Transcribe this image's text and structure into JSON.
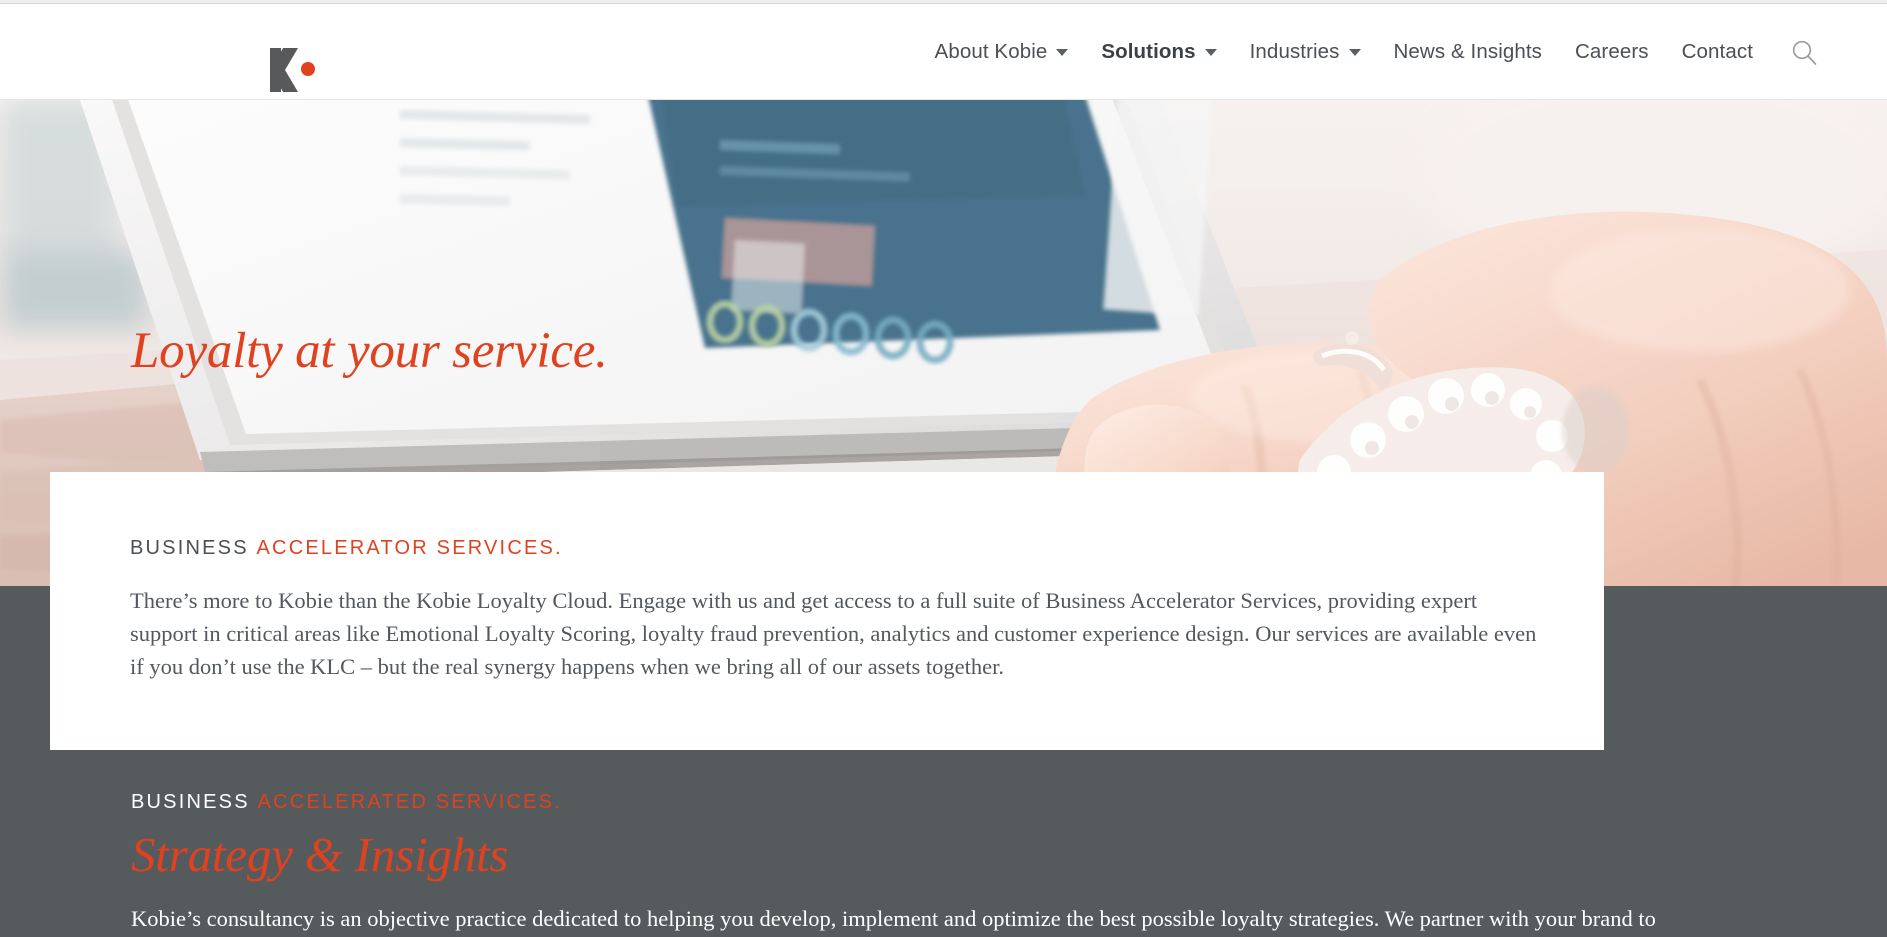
{
  "header": {
    "logo_name": "kobie-logo",
    "nav": [
      {
        "label": "About Kobie",
        "has_caret": true,
        "active": false
      },
      {
        "label": "Solutions",
        "has_caret": true,
        "active": true
      },
      {
        "label": "Industries",
        "has_caret": true,
        "active": false
      },
      {
        "label": "News & Insights",
        "has_caret": false,
        "active": false
      },
      {
        "label": "Careers",
        "has_caret": false,
        "active": false
      },
      {
        "label": "Contact",
        "has_caret": false,
        "active": false
      }
    ],
    "search_icon": "search-icon"
  },
  "hero": {
    "title": "Loyalty at your service.",
    "image_alt": "hands typing on a laptop at a wooden desk"
  },
  "card": {
    "eyebrow_primary": "BUSINESS",
    "eyebrow_accent": "ACCELERATOR SERVICES.",
    "paragraph": "There’s more to Kobie than the Kobie Loyalty Cloud. Engage with us and get access to a full suite of Business Accelerator Services, providing expert support in critical areas like Emotional Loyalty Scoring, loyalty fraud prevention, analytics and customer experience design. Our services are available even if you don’t use the KLC – but the real synergy happens when we bring all of our assets together."
  },
  "dark_section": {
    "eyebrow_primary": "BUSINESS",
    "eyebrow_accent": "ACCELERATED SERVICES.",
    "heading": "Strategy & Insights",
    "paragraph": "Kobie’s consultancy is an objective practice dedicated to helping you develop, implement and optimize the best possible loyalty strategies. We partner with your brand to"
  },
  "colors": {
    "accent": "#e0421f",
    "dark_band": "#555a5c",
    "logo_gray": "#57595b",
    "body_text": "#53585f",
    "nav_text": "#4b4f56"
  }
}
